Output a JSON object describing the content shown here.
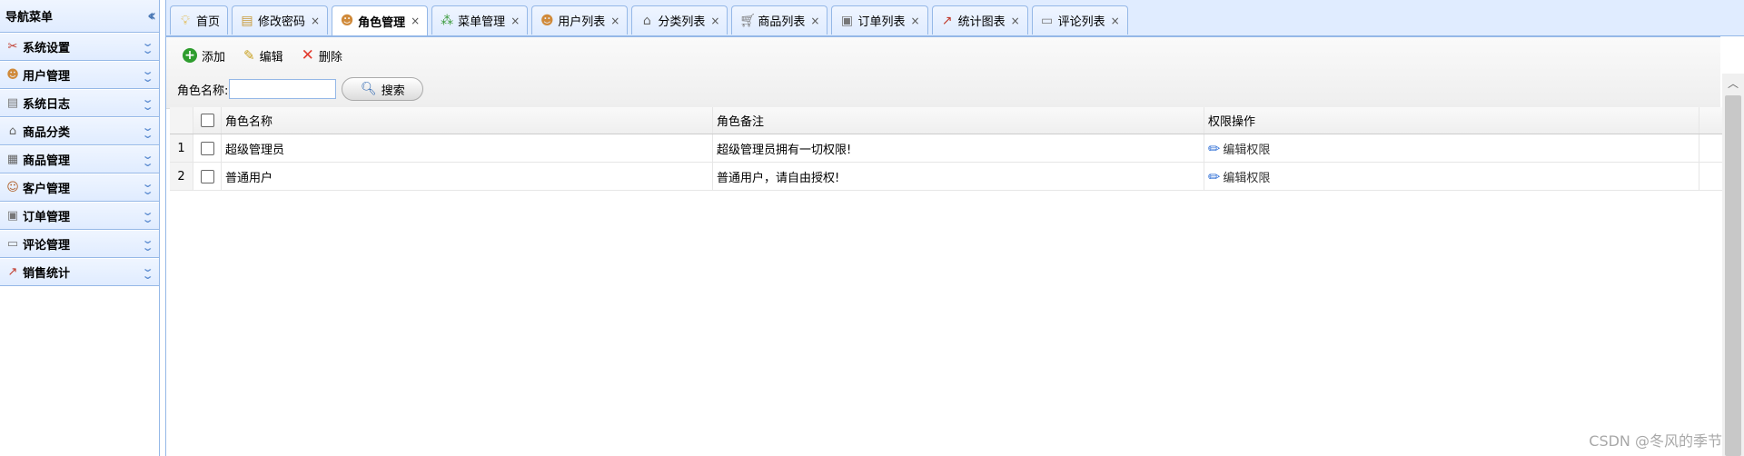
{
  "nav": {
    "title": "导航菜单",
    "items": [
      {
        "label": "系统设置",
        "icon": "tools-icon"
      },
      {
        "label": "用户管理",
        "icon": "user-icon"
      },
      {
        "label": "系统日志",
        "icon": "log-icon"
      },
      {
        "label": "商品分类",
        "icon": "category-icon"
      },
      {
        "label": "商品管理",
        "icon": "product-icon"
      },
      {
        "label": "客户管理",
        "icon": "customer-icon"
      },
      {
        "label": "订单管理",
        "icon": "order-icon"
      },
      {
        "label": "评论管理",
        "icon": "comment-icon"
      },
      {
        "label": "销售统计",
        "icon": "stats-icon"
      }
    ]
  },
  "tabs": [
    {
      "label": "首页",
      "closable": false,
      "active": false,
      "icon": "bulb-icon"
    },
    {
      "label": "修改密码",
      "closable": true,
      "active": false,
      "icon": "password-icon"
    },
    {
      "label": "角色管理",
      "closable": true,
      "active": true,
      "icon": "role-icon"
    },
    {
      "label": "菜单管理",
      "closable": true,
      "active": false,
      "icon": "menu-tree-icon"
    },
    {
      "label": "用户列表",
      "closable": true,
      "active": false,
      "icon": "users-icon"
    },
    {
      "label": "分类列表",
      "closable": true,
      "active": false,
      "icon": "category-tree-icon"
    },
    {
      "label": "商品列表",
      "closable": true,
      "active": false,
      "icon": "cart-icon"
    },
    {
      "label": "订单列表",
      "closable": true,
      "active": false,
      "icon": "order-list-icon"
    },
    {
      "label": "统计图表",
      "closable": true,
      "active": false,
      "icon": "chart-icon"
    },
    {
      "label": "评论列表",
      "closable": true,
      "active": false,
      "icon": "comments-icon"
    }
  ],
  "toolbar": {
    "add_label": "添加",
    "edit_label": "编辑",
    "delete_label": "删除"
  },
  "search": {
    "label": "角色名称:",
    "value": "",
    "button_label": "搜索"
  },
  "grid": {
    "columns": [
      "角色名称",
      "角色备注",
      "权限操作"
    ],
    "rows": [
      {
        "num": "1",
        "name": "超级管理员",
        "note": "超级管理员拥有一切权限!",
        "action": "编辑权限"
      },
      {
        "num": "2",
        "name": "普通用户",
        "note": "普通用户，请自由授权!",
        "action": "编辑权限"
      }
    ]
  },
  "watermark": "CSDN @冬风的季节"
}
